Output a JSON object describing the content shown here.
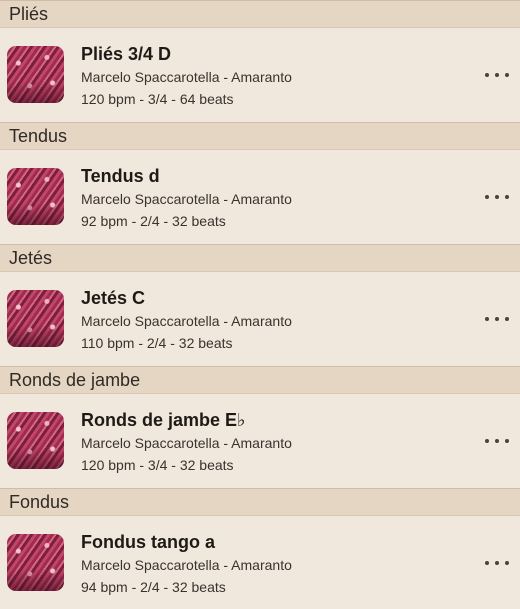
{
  "sections": [
    {
      "header": "Pliés",
      "track": {
        "title": "Pliés 3/4 D",
        "artist": "Marcelo Spaccarotella - Amaranto",
        "meta": "120 bpm - 3/4 - 64 beats"
      }
    },
    {
      "header": "Tendus",
      "track": {
        "title": "Tendus d",
        "artist": "Marcelo Spaccarotella - Amaranto",
        "meta": "92 bpm - 2/4 - 32 beats"
      }
    },
    {
      "header": "Jetés",
      "track": {
        "title": "Jetés C",
        "artist": "Marcelo Spaccarotella - Amaranto",
        "meta": "110 bpm - 2/4 - 32 beats"
      }
    },
    {
      "header": "Ronds de jambe",
      "track": {
        "title": "Ronds de jambe E♭",
        "artist": "Marcelo Spaccarotella - Amaranto",
        "meta": "120 bpm - 3/4 - 32 beats"
      }
    },
    {
      "header": "Fondus",
      "track": {
        "title": "Fondus tango a",
        "artist": "Marcelo Spaccarotella - Amaranto",
        "meta": "94 bpm - 2/4 - 32 beats"
      }
    }
  ],
  "icons": {
    "thumbnail": "album-art-icon",
    "more": "more-options-icon"
  },
  "colors": {
    "background": "#f0e8dd",
    "section_header": "#e5d6c4",
    "text": "#1f1a16"
  }
}
